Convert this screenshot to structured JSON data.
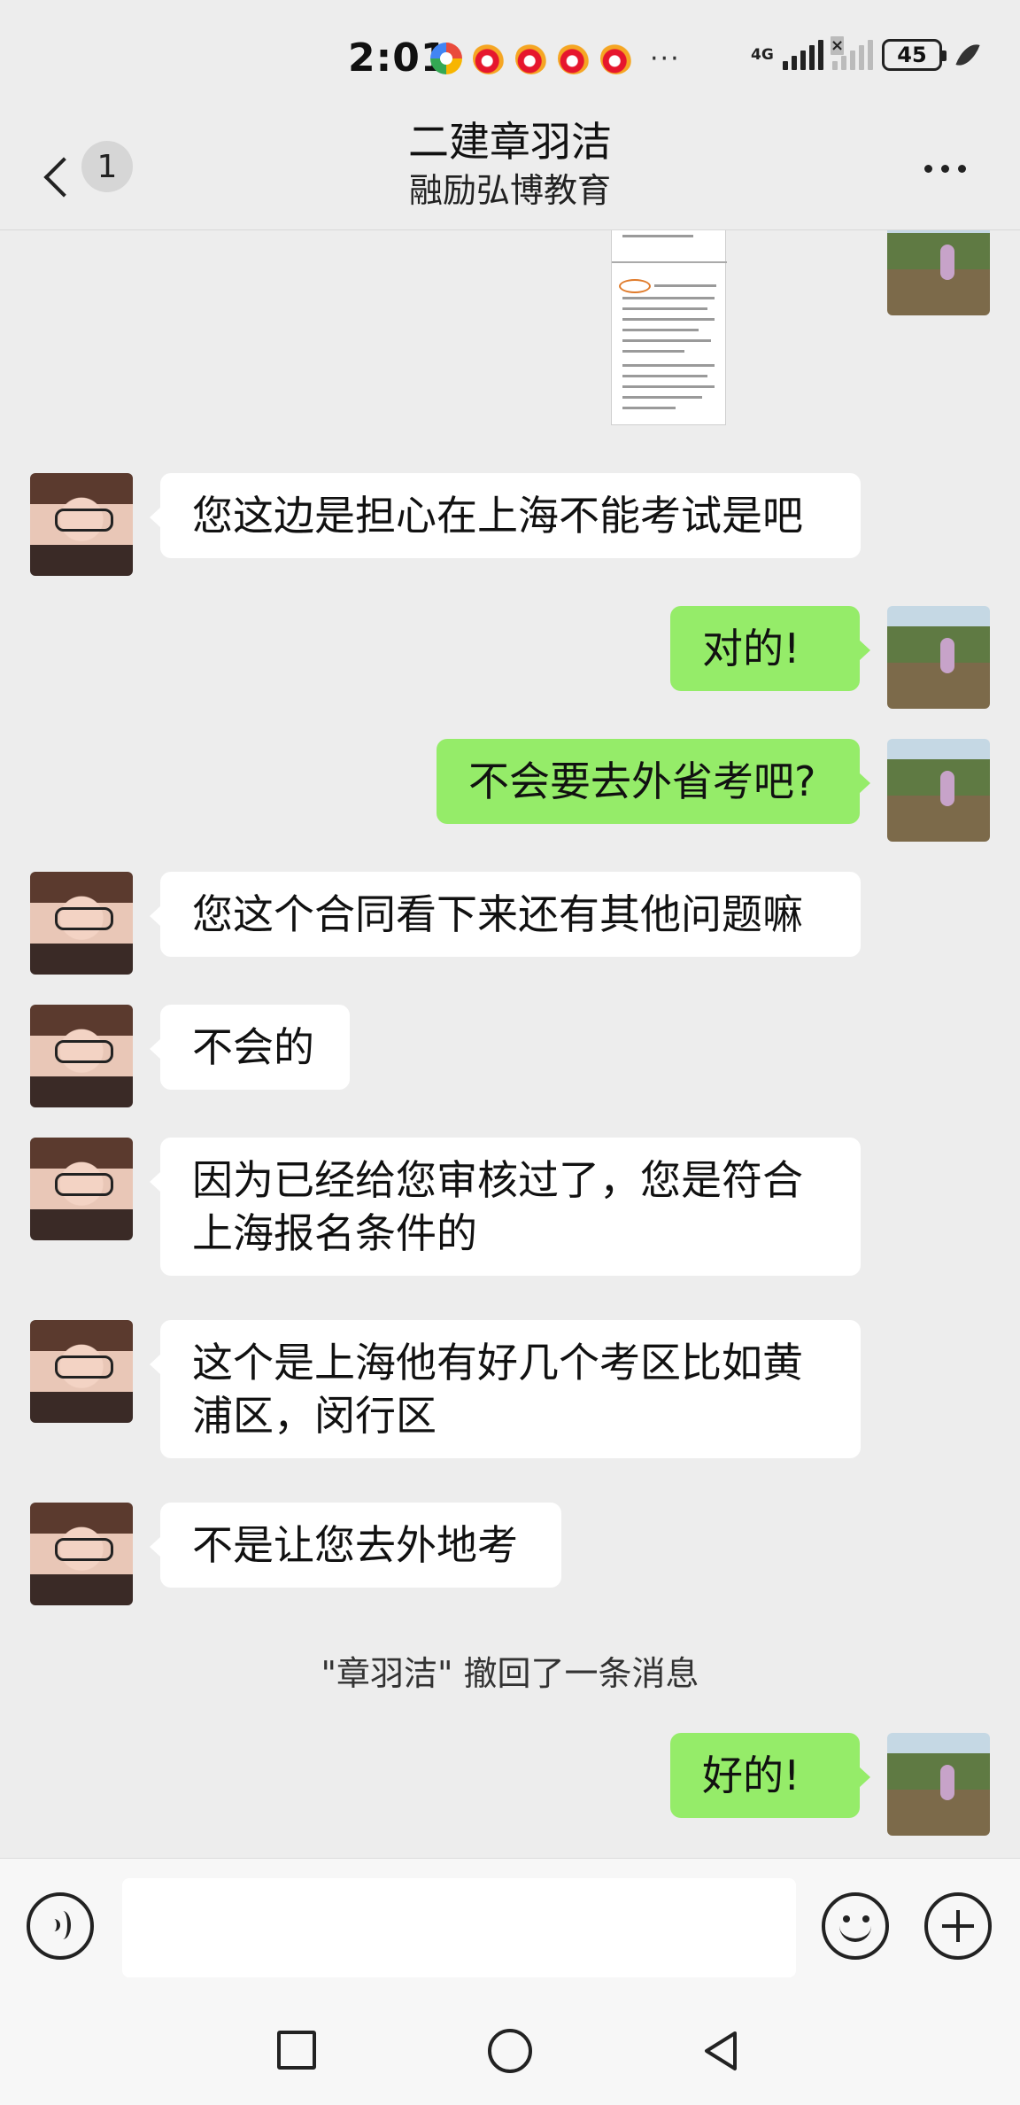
{
  "status_bar": {
    "time": "2:01",
    "app_icons": [
      "multicolor-app-icon",
      "weibo-icon",
      "weibo-icon",
      "weibo-icon",
      "weibo-icon"
    ],
    "more": "···",
    "network": "4G",
    "battery": "45"
  },
  "header": {
    "title": "二建章羽洁",
    "subtitle": "融励弘博教育",
    "unread_count": "1"
  },
  "messages": [
    {
      "side": "out",
      "type": "image"
    },
    {
      "side": "in",
      "text": "您这边是担心在上海不能考试是吧"
    },
    {
      "side": "out",
      "text": "对的!"
    },
    {
      "side": "out",
      "text": "不会要去外省考吧?"
    },
    {
      "side": "in",
      "text": "您这个合同看下来还有其他问题嘛"
    },
    {
      "side": "in",
      "text": "不会的"
    },
    {
      "side": "in",
      "text": "因为已经给您审核过了，您是符合上海报名条件的"
    },
    {
      "side": "in",
      "text": "这个是上海他有好几个考区比如黄浦区，闵行区"
    },
    {
      "side": "in",
      "text": "不是让您去外地考"
    },
    {
      "side": "system",
      "text": "\"章羽洁\" 撤回了一条消息"
    },
    {
      "side": "out",
      "text": "好的!"
    }
  ],
  "input": {
    "placeholder": ""
  },
  "colors": {
    "background": "#ededed",
    "outgoing_bubble": "#95ec69",
    "incoming_bubble": "#ffffff"
  }
}
